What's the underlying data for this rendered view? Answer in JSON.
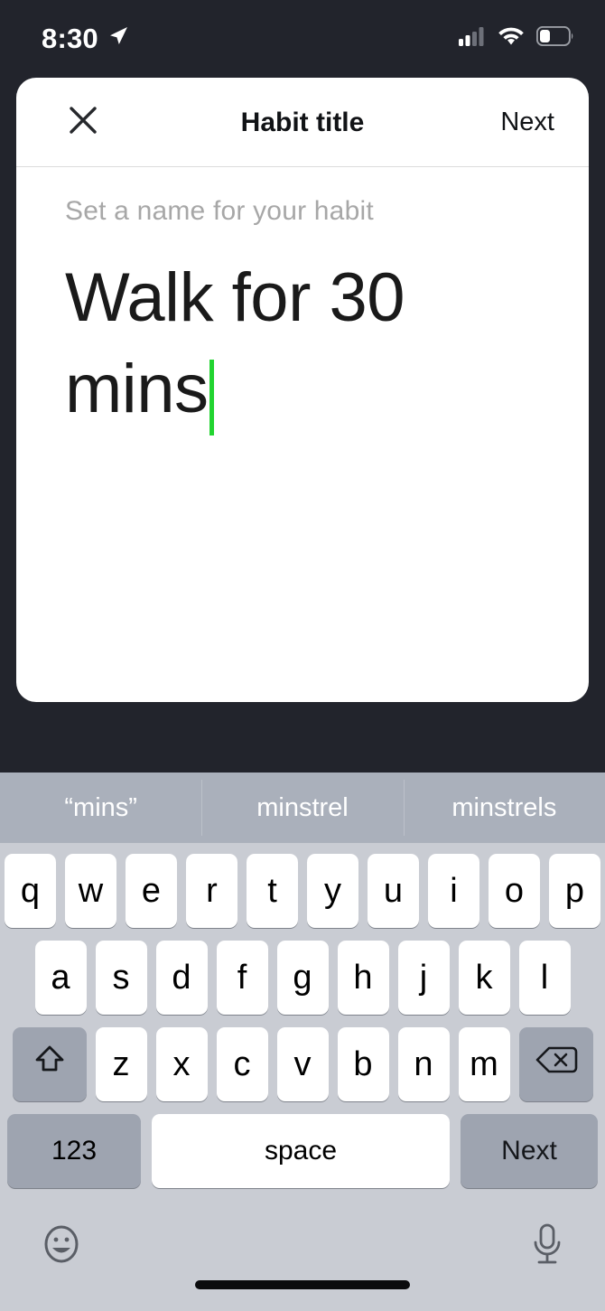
{
  "status_bar": {
    "time": "8:30",
    "location_icon": "location-arrow-icon",
    "signal_icon": "cellular-signal-icon",
    "wifi_icon": "wifi-icon",
    "battery_icon": "battery-icon"
  },
  "modal": {
    "close_icon": "close-x-icon",
    "title": "Habit title",
    "next_label": "Next",
    "field_label": "Set a name for your habit",
    "input_value": "Walk for 30 mins",
    "input_placeholder": "Set a name for your habit",
    "caret_color": "#22d430"
  },
  "keyboard": {
    "suggestions": [
      "“mins”",
      "minstrel",
      "minstrels"
    ],
    "row1": [
      "q",
      "w",
      "e",
      "r",
      "t",
      "y",
      "u",
      "i",
      "o",
      "p"
    ],
    "row2": [
      "a",
      "s",
      "d",
      "f",
      "g",
      "h",
      "j",
      "k",
      "l"
    ],
    "row3": [
      "z",
      "x",
      "c",
      "v",
      "b",
      "n",
      "m"
    ],
    "shift_icon": "shift-arrow-icon",
    "backspace_icon": "backspace-delete-icon",
    "numbers_label": "123",
    "space_label": "space",
    "return_label": "Next",
    "emoji_icon": "emoji-smiley-icon",
    "dictation_icon": "microphone-icon"
  },
  "colors": {
    "background": "#22242c",
    "card": "#ffffff",
    "keyboard_bg": "#c9ccd3",
    "predictive_bg": "#aab0bb",
    "key_light": "#ffffff",
    "key_dark": "#9ea4b0",
    "caret_green": "#22d430"
  }
}
